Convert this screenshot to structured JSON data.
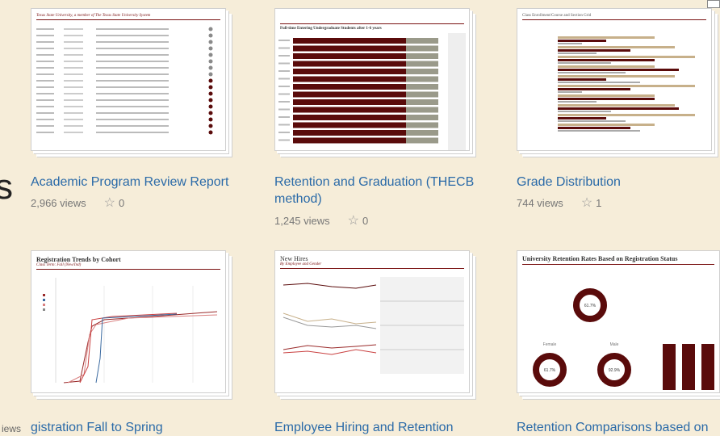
{
  "edge": {
    "letter": "s",
    "views_fragment": "iews"
  },
  "cards": [
    {
      "title": "Academic Program Review Report",
      "views": "2,966 views",
      "favorites": "0",
      "thumb_title": "Texas State University, a member of The Texas State University System"
    },
    {
      "title": "Retention and Graduation (THECB method)",
      "views": "1,245 views",
      "favorites": "0",
      "thumb_title": "Full-time Entering Undergraduate Students after 1-6 years"
    },
    {
      "title": "Grade Distribution",
      "views": "744 views",
      "favorites": "1",
      "thumb_title": "Class Enrollment/Course and Section Grid"
    },
    {
      "title": "gistration Fall to Spring",
      "thumb_title": "Registration Trends by Cohort",
      "thumb_sub": "Class Term: Fall (New/Ind)"
    },
    {
      "title": "Employee Hiring and Retention",
      "thumb_title": "New Hires",
      "thumb_sub": "By Employee and Gender"
    },
    {
      "title": "Retention Comparisons based on",
      "thumb_title": "University Retention Rates Based on Registration Status",
      "donut_center": "61.7%",
      "donut_a": "61.7%",
      "donut_b": "92.9%",
      "left_label": "Female",
      "right_label": "Male"
    }
  ],
  "colors": {
    "maroon": "#5a0b0b",
    "tan": "#c7b08a",
    "gray": "#9a9a8a",
    "link": "#2a6aa8",
    "bg": "#f6edd9"
  },
  "icons": {
    "favorite": "star-outline-icon"
  }
}
